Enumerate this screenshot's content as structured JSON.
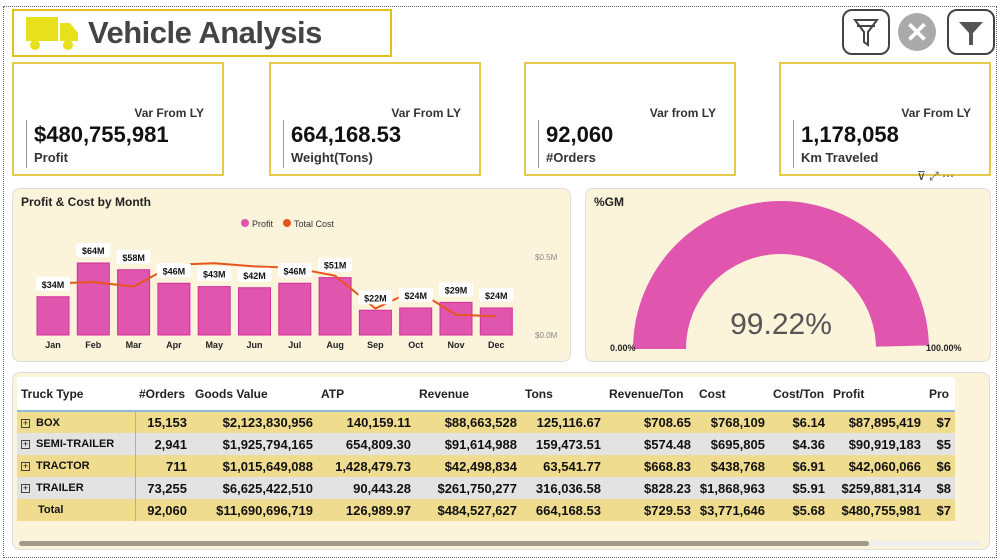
{
  "header": {
    "title": "Vehicle Analysis",
    "icons": [
      "truck-icon",
      "clear-filter-icon",
      "close-icon",
      "filter-icon"
    ]
  },
  "kpis": [
    {
      "var_label": "Var From LY",
      "value": "$480,755,981",
      "label": "Profit"
    },
    {
      "var_label": "Var From LY",
      "value": "664,168.53",
      "label": "Weight(Tons)"
    },
    {
      "var_label": "Var from LY",
      "value": "92,060",
      "label": "#Orders"
    },
    {
      "var_label": "Var From LY",
      "value": "1,178,058",
      "label": "Km Traveled"
    }
  ],
  "chart_data": [
    {
      "type": "bar+line",
      "title": "Profit & Cost by Month",
      "categories": [
        "Jan",
        "Feb",
        "Mar",
        "Apr",
        "May",
        "Jun",
        "Jul",
        "Aug",
        "Sep",
        "Oct",
        "Nov",
        "Dec"
      ],
      "series": [
        {
          "name": "Profit",
          "type": "bar",
          "color": "#e055ae",
          "values": [
            34,
            64,
            58,
            46,
            43,
            42,
            46,
            51,
            22,
            24,
            29,
            24
          ],
          "labels": [
            "$34M",
            "$64M",
            "$58M",
            "$46M",
            "$43M",
            "$42M",
            "$46M",
            "$51M",
            "$22M",
            "$24M",
            "$29M",
            "$24M"
          ]
        },
        {
          "name": "Total Cost",
          "type": "line",
          "color": "#e5561e",
          "axis": "secondary",
          "values": [
            0.33,
            0.34,
            0.31,
            0.45,
            0.46,
            0.44,
            0.43,
            0.38,
            0.17,
            0.29,
            0.13,
            0.12
          ]
        }
      ],
      "secondary_axis": {
        "ticks": [
          "$0.5M",
          "$0.0M"
        ],
        "range": [
          0,
          0.5
        ]
      },
      "legend": "top-center"
    },
    {
      "type": "gauge",
      "title": "%GM",
      "value": 99.22,
      "value_label": "99.22%",
      "min_label": "0.00%",
      "max_label": "100.00%",
      "color": "#e055ae"
    }
  ],
  "table": {
    "columns": [
      "Truck Type",
      "#Orders",
      "Goods Value",
      "ATP",
      "Revenue",
      "Tons",
      "Revenue/Ton",
      "Cost",
      "Cost/Ton",
      "Profit",
      "Pro"
    ],
    "rows": [
      [
        "BOX",
        "15,153",
        "$2,123,830,956",
        "140,159.11",
        "$88,663,528",
        "125,116.67",
        "$708.65",
        "$768,109",
        "$6.14",
        "$87,895,419",
        "$7"
      ],
      [
        "SEMI-TRAILER",
        "2,941",
        "$1,925,794,165",
        "654,809.30",
        "$91,614,988",
        "159,473.51",
        "$574.48",
        "$695,805",
        "$4.36",
        "$90,919,183",
        "$5"
      ],
      [
        "TRACTOR",
        "711",
        "$1,015,649,088",
        "1,428,479.73",
        "$42,498,834",
        "63,541.77",
        "$668.83",
        "$438,768",
        "$6.91",
        "$42,060,066",
        "$6"
      ],
      [
        "TRAILER",
        "73,255",
        "$6,625,422,510",
        "90,443.28",
        "$261,750,277",
        "316,036.58",
        "$828.23",
        "$1,868,963",
        "$5.91",
        "$259,881,314",
        "$8"
      ]
    ],
    "total": [
      "Total",
      "92,060",
      "$11,690,696,719",
      "126,989.97",
      "$484,527,627",
      "664,168.53",
      "$729.53",
      "$3,771,646",
      "$5.68",
      "$480,755,981",
      "$7"
    ]
  }
}
